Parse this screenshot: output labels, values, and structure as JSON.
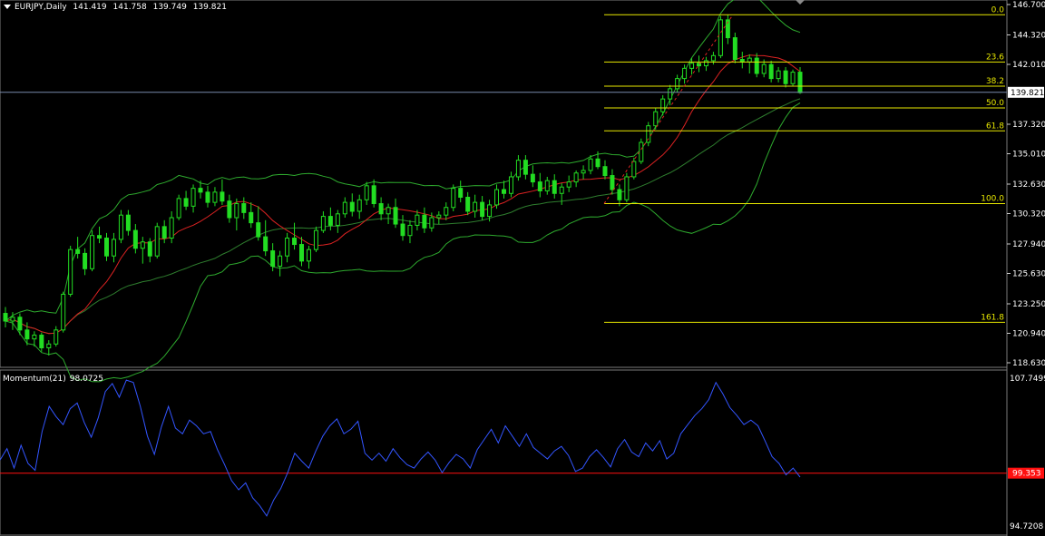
{
  "header": {
    "symbol": "EURJPY,Daily",
    "open": "141.419",
    "high": "141.758",
    "low": "139.749",
    "close": "139.821"
  },
  "price_axis": {
    "ticks": [
      "146.700",
      "144.320",
      "142.010",
      "139.821",
      "137.320",
      "135.010",
      "132.630",
      "130.320",
      "127.940",
      "125.630",
      "123.250",
      "120.940",
      "118.630"
    ],
    "current_price": "139.821"
  },
  "fibonacci": {
    "levels": [
      {
        "label": "0.0",
        "price": 145.9
      },
      {
        "label": "23.6",
        "price": 142.2
      },
      {
        "label": "38.2",
        "price": 140.3
      },
      {
        "label": "50.0",
        "price": 138.6
      },
      {
        "label": "61.8",
        "price": 136.8
      },
      {
        "label": "100.0",
        "price": 131.1
      },
      {
        "label": "161.8",
        "price": 121.8
      }
    ]
  },
  "momentum": {
    "title": "Momentum(21)",
    "last_value": "98.0725",
    "axis_top": "107.7499",
    "axis_bottom": "94.7208",
    "level_label": "99.353"
  },
  "colors": {
    "background": "#000000",
    "candle": "#22dd22",
    "ma_fast": "#dd2222",
    "ma_slow": "#2e7d2e",
    "bands": "#2eaa2e",
    "fib": "#e8e800",
    "momentum": "#3355ff",
    "level_line": "#ff1010",
    "grid": "#ffffff"
  },
  "chart_data": {
    "type": "candlestick",
    "title": "EURJPY,Daily",
    "ylim": [
      118.63,
      146.7
    ],
    "ohlc": [
      [
        122.5,
        123.0,
        121.4,
        121.9
      ],
      [
        121.9,
        122.6,
        121.2,
        122.2
      ],
      [
        122.2,
        122.5,
        120.8,
        121.2
      ],
      [
        121.2,
        121.8,
        120.0,
        120.5
      ],
      [
        120.5,
        121.1,
        119.9,
        120.8
      ],
      [
        120.8,
        121.0,
        119.5,
        119.8
      ],
      [
        119.8,
        120.4,
        119.2,
        120.1
      ],
      [
        120.1,
        121.5,
        119.9,
        121.2
      ],
      [
        121.2,
        124.2,
        121.0,
        124.0
      ],
      [
        124.0,
        127.8,
        123.8,
        127.5
      ],
      [
        127.5,
        128.5,
        126.8,
        127.2
      ],
      [
        127.2,
        127.6,
        125.5,
        126.0
      ],
      [
        126.0,
        129.0,
        125.8,
        128.6
      ],
      [
        128.6,
        129.3,
        128.0,
        128.4
      ],
      [
        128.4,
        128.8,
        126.6,
        127.0
      ],
      [
        127.0,
        128.8,
        126.5,
        128.3
      ],
      [
        128.3,
        130.6,
        128.0,
        130.2
      ],
      [
        130.2,
        130.6,
        128.6,
        129.0
      ],
      [
        129.0,
        129.5,
        127.2,
        127.6
      ],
      [
        127.6,
        128.5,
        126.4,
        128.1
      ],
      [
        128.1,
        128.4,
        126.5,
        127.0
      ],
      [
        127.0,
        129.6,
        126.8,
        129.3
      ],
      [
        129.3,
        129.8,
        128.0,
        128.4
      ],
      [
        128.4,
        130.5,
        128.0,
        130.0
      ],
      [
        130.0,
        131.8,
        129.8,
        131.5
      ],
      [
        131.5,
        132.1,
        130.6,
        130.9
      ],
      [
        130.9,
        132.6,
        130.4,
        132.3
      ],
      [
        132.3,
        132.9,
        131.5,
        132.0
      ],
      [
        132.0,
        132.5,
        130.8,
        131.2
      ],
      [
        131.2,
        132.4,
        130.9,
        132.0
      ],
      [
        132.0,
        133.0,
        131.0,
        131.3
      ],
      [
        131.3,
        131.8,
        129.6,
        130.0
      ],
      [
        130.0,
        131.5,
        129.0,
        131.1
      ],
      [
        131.1,
        131.6,
        129.9,
        130.4
      ],
      [
        130.4,
        131.2,
        129.2,
        129.6
      ],
      [
        129.6,
        130.9,
        128.2,
        128.5
      ],
      [
        128.5,
        129.8,
        127.0,
        127.4
      ],
      [
        127.4,
        128.0,
        125.8,
        126.2
      ],
      [
        126.2,
        127.4,
        125.4,
        127.0
      ],
      [
        127.0,
        128.8,
        126.5,
        128.4
      ],
      [
        128.4,
        129.6,
        127.5,
        127.9
      ],
      [
        127.9,
        128.5,
        126.2,
        126.6
      ],
      [
        126.6,
        127.8,
        126.0,
        127.5
      ],
      [
        127.5,
        129.3,
        127.3,
        129.0
      ],
      [
        129.0,
        130.5,
        128.8,
        130.1
      ],
      [
        130.1,
        130.8,
        129.0,
        129.4
      ],
      [
        129.4,
        130.6,
        128.8,
        130.3
      ],
      [
        130.3,
        131.6,
        130.0,
        131.2
      ],
      [
        131.2,
        131.9,
        130.1,
        130.5
      ],
      [
        130.5,
        131.8,
        129.9,
        131.4
      ],
      [
        131.4,
        132.8,
        131.0,
        132.5
      ],
      [
        132.5,
        133.0,
        130.8,
        131.1
      ],
      [
        131.1,
        131.6,
        129.8,
        130.3
      ],
      [
        130.3,
        131.1,
        129.5,
        130.8
      ],
      [
        130.8,
        131.5,
        129.2,
        129.5
      ],
      [
        129.5,
        130.2,
        128.2,
        128.6
      ],
      [
        128.6,
        129.8,
        128.0,
        129.4
      ],
      [
        129.4,
        130.6,
        129.0,
        130.2
      ],
      [
        130.2,
        130.8,
        128.8,
        129.2
      ],
      [
        129.2,
        130.4,
        128.9,
        130.0
      ],
      [
        130.0,
        130.5,
        129.5,
        130.2
      ],
      [
        130.2,
        131.2,
        129.8,
        130.8
      ],
      [
        130.8,
        132.6,
        130.5,
        132.3
      ],
      [
        132.3,
        132.9,
        131.2,
        131.6
      ],
      [
        131.6,
        132.0,
        130.2,
        130.5
      ],
      [
        130.5,
        131.8,
        130.0,
        131.2
      ],
      [
        131.2,
        131.7,
        129.8,
        130.1
      ],
      [
        130.1,
        131.4,
        129.7,
        131.0
      ],
      [
        131.0,
        132.6,
        130.7,
        132.2
      ],
      [
        132.2,
        132.9,
        131.5,
        131.9
      ],
      [
        131.9,
        133.6,
        131.6,
        133.2
      ],
      [
        133.2,
        134.9,
        132.9,
        134.5
      ],
      [
        134.5,
        134.9,
        133.0,
        133.4
      ],
      [
        133.4,
        134.1,
        132.4,
        132.8
      ],
      [
        132.8,
        133.5,
        131.6,
        132.1
      ],
      [
        132.1,
        133.2,
        131.8,
        132.9
      ],
      [
        132.9,
        133.4,
        131.5,
        131.9
      ],
      [
        131.9,
        132.7,
        131.0,
        132.4
      ],
      [
        132.4,
        133.3,
        132.0,
        132.8
      ],
      [
        132.8,
        133.7,
        132.4,
        133.5
      ],
      [
        133.5,
        134.1,
        133.0,
        133.7
      ],
      [
        133.7,
        134.9,
        133.4,
        134.6
      ],
      [
        134.6,
        135.2,
        133.8,
        134.0
      ],
      [
        134.0,
        134.5,
        133.0,
        133.3
      ],
      [
        133.3,
        133.8,
        131.8,
        132.2
      ],
      [
        132.2,
        132.6,
        130.9,
        131.4
      ],
      [
        131.4,
        133.5,
        131.2,
        133.2
      ],
      [
        133.2,
        134.7,
        133.0,
        134.4
      ],
      [
        134.4,
        136.2,
        134.2,
        135.9
      ],
      [
        135.9,
        137.5,
        135.6,
        137.2
      ],
      [
        137.2,
        138.6,
        136.9,
        138.3
      ],
      [
        138.3,
        139.6,
        138.0,
        139.3
      ],
      [
        139.3,
        140.4,
        138.8,
        140.1
      ],
      [
        140.1,
        141.2,
        139.8,
        140.9
      ],
      [
        140.9,
        142.0,
        140.5,
        141.7
      ],
      [
        141.7,
        142.5,
        141.2,
        142.1
      ],
      [
        142.1,
        142.7,
        141.4,
        141.9
      ],
      [
        141.9,
        142.6,
        141.5,
        142.3
      ],
      [
        142.3,
        143.0,
        142.0,
        142.7
      ],
      [
        142.7,
        145.8,
        142.5,
        145.5
      ],
      [
        145.5,
        145.9,
        143.6,
        144.1
      ],
      [
        144.1,
        144.5,
        142.1,
        142.4
      ],
      [
        142.4,
        143.0,
        141.7,
        142.2
      ],
      [
        142.2,
        142.8,
        141.3,
        142.5
      ],
      [
        142.5,
        142.9,
        141.0,
        141.3
      ],
      [
        141.3,
        142.4,
        141.0,
        142.0
      ],
      [
        142.0,
        142.3,
        140.6,
        140.9
      ],
      [
        140.9,
        141.8,
        140.6,
        141.5
      ],
      [
        141.5,
        141.8,
        140.2,
        140.5
      ],
      [
        140.5,
        141.6,
        140.3,
        141.4
      ],
      [
        141.4,
        141.8,
        139.7,
        139.8
      ]
    ],
    "series": [
      {
        "name": "Momentum(21)",
        "values": [
          100.5,
          101.5,
          99.8,
          101.8,
          100.2,
          99.6,
          103.0,
          105.2,
          104.3,
          103.6,
          105.0,
          105.5,
          103.8,
          102.5,
          104.2,
          106.5,
          107.2,
          106.0,
          107.5,
          107.3,
          105.2,
          102.6,
          101.0,
          103.4,
          105.2,
          103.3,
          102.8,
          104.0,
          103.5,
          102.8,
          103.0,
          101.4,
          100.1,
          98.7,
          97.9,
          98.5,
          97.2,
          96.5,
          95.6,
          97.0,
          98.0,
          99.4,
          101.1,
          100.4,
          99.8,
          101.3,
          102.6,
          103.5,
          104.1,
          102.8,
          103.2,
          103.9,
          101.1,
          100.5,
          101.1,
          100.4,
          101.5,
          100.7,
          100.1,
          99.8,
          100.6,
          101.2,
          100.5,
          99.4,
          100.3,
          101.0,
          100.6,
          99.8,
          101.4,
          102.3,
          103.2,
          102.0,
          103.5,
          102.6,
          101.7,
          102.8,
          101.6,
          101.1,
          100.6,
          101.3,
          101.7,
          100.9,
          99.5,
          99.8,
          100.8,
          101.4,
          100.7,
          99.9,
          101.5,
          102.3,
          101.2,
          100.8,
          102.0,
          101.3,
          102.2,
          100.6,
          101.1,
          102.8,
          103.6,
          104.4,
          105.0,
          105.8,
          107.3,
          106.3,
          105.1,
          104.4,
          103.6,
          104.0,
          103.5,
          102.2,
          100.8,
          100.2,
          99.2,
          99.8,
          99.0
        ]
      }
    ]
  }
}
